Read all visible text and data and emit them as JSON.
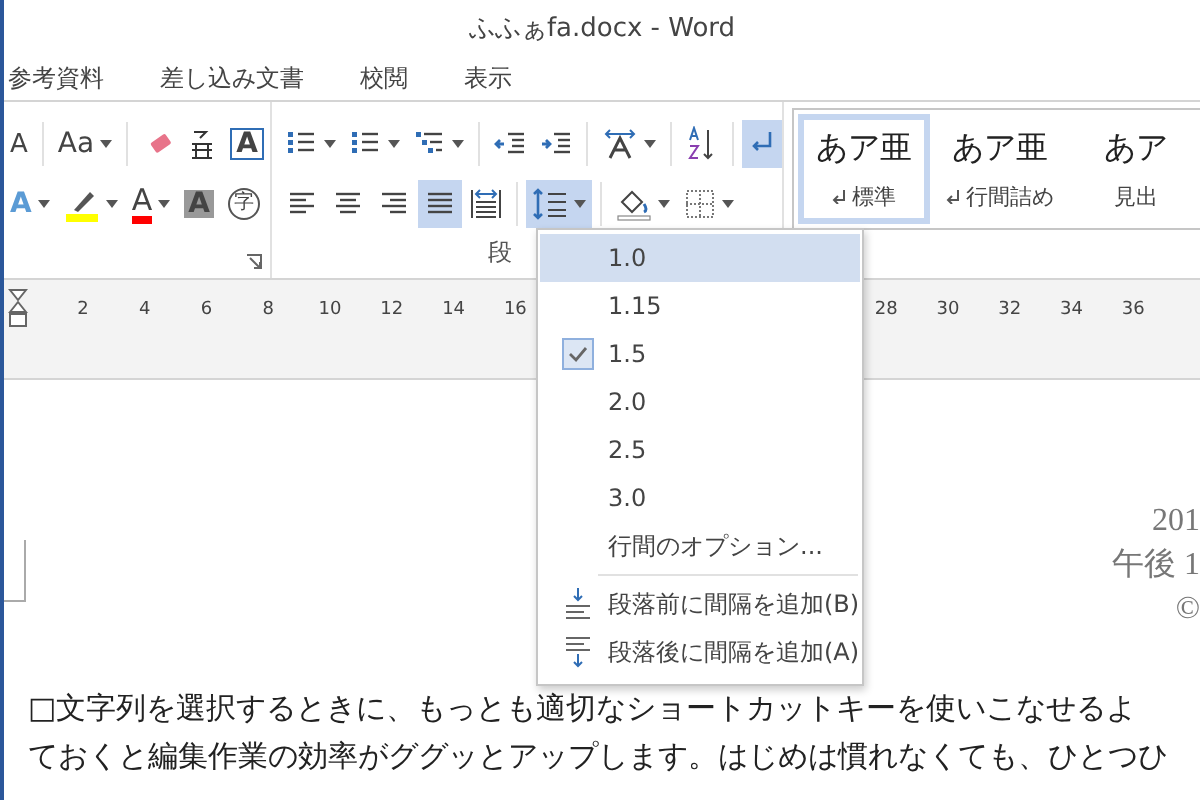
{
  "window": {
    "title": "ふふぁfa.docx - Word"
  },
  "tabs": [
    {
      "label": "参考資料",
      "selected": false
    },
    {
      "label": "差し込み文書",
      "selected": false
    },
    {
      "label": "校閲",
      "selected": false
    },
    {
      "label": "表示",
      "selected": false
    }
  ],
  "font_group": {
    "row1": [
      {
        "kind": "grow-font",
        "glyph": "A",
        "dropdown": false,
        "on": false
      },
      {
        "kind": "separator"
      },
      {
        "kind": "change-case",
        "glyph": "Aa",
        "dropdown": true,
        "on": false
      },
      {
        "kind": "separator"
      },
      {
        "kind": "clear-format",
        "dropdown": false,
        "on": false
      },
      {
        "kind": "furigana",
        "dropdown": false,
        "on": false
      },
      {
        "kind": "boxed-char",
        "glyph": "A",
        "dropdown": false,
        "on": false
      }
    ],
    "row2": [
      {
        "kind": "text-effects",
        "glyph": "A",
        "dropdown": true,
        "on": false
      },
      {
        "kind": "highlight",
        "dropdown": true,
        "on": false
      },
      {
        "kind": "font-color",
        "glyph": "A",
        "dropdown": true,
        "on": false
      },
      {
        "kind": "char-shading",
        "glyph": "A",
        "dropdown": false,
        "on": false
      },
      {
        "kind": "enclosed-char",
        "glyph": "字",
        "dropdown": false,
        "on": false
      }
    ]
  },
  "paragraph_group": {
    "label": "段",
    "row1": [
      {
        "kind": "bullets",
        "dropdown": true,
        "on": false
      },
      {
        "kind": "numbering",
        "dropdown": true,
        "on": false
      },
      {
        "kind": "multilevel",
        "dropdown": true,
        "on": false
      },
      {
        "kind": "separator"
      },
      {
        "kind": "outdent",
        "dropdown": false,
        "on": false
      },
      {
        "kind": "indent",
        "dropdown": false,
        "on": false
      },
      {
        "kind": "separator"
      },
      {
        "kind": "text-direction",
        "dropdown": true,
        "on": false
      },
      {
        "kind": "separator"
      },
      {
        "kind": "sort",
        "dropdown": false,
        "on": false
      },
      {
        "kind": "separator"
      },
      {
        "kind": "show-marks",
        "dropdown": false,
        "on": true
      }
    ],
    "row2": [
      {
        "kind": "align-left",
        "dropdown": false,
        "on": false
      },
      {
        "kind": "align-center",
        "dropdown": false,
        "on": false
      },
      {
        "kind": "align-right",
        "dropdown": false,
        "on": false
      },
      {
        "kind": "justify",
        "dropdown": false,
        "on": true
      },
      {
        "kind": "distribute",
        "dropdown": false,
        "on": false
      },
      {
        "kind": "separator"
      },
      {
        "kind": "line-spacing",
        "dropdown": true,
        "on": true
      },
      {
        "kind": "separator"
      },
      {
        "kind": "shading",
        "dropdown": true,
        "on": false
      },
      {
        "kind": "borders",
        "dropdown": true,
        "on": false
      }
    ]
  },
  "styles": [
    {
      "preview": "あア亜",
      "name": "標準",
      "paragraph_mark": true,
      "selected": true
    },
    {
      "preview": "あア亜",
      "name": "行間詰め",
      "paragraph_mark": true,
      "selected": false
    },
    {
      "preview": "あア",
      "name": "見出",
      "paragraph_mark": false,
      "selected": false
    }
  ],
  "ruler": {
    "left_numbers": [
      "2",
      "4",
      "6",
      "8",
      "10",
      "12",
      "14",
      "16"
    ],
    "right_numbers": [
      "28",
      "30",
      "32",
      "34",
      "36"
    ]
  },
  "document": {
    "side_lines": [
      "201",
      "午後 1",
      "©"
    ],
    "paragraphs": [
      "□文字列を選択するときに、もっとも適切なショートカットキーを使いこなせるよ",
      "ておくと編集作業の効率がググッとアップします。はじめは慣れなくても、ひとつひ"
    ]
  },
  "line_spacing_menu": {
    "items": [
      {
        "kind": "spacing",
        "label": "1.0",
        "highlighted": true,
        "checked": false
      },
      {
        "kind": "spacing",
        "label": "1.15",
        "highlighted": false,
        "checked": false
      },
      {
        "kind": "spacing",
        "label": "1.5",
        "highlighted": false,
        "checked": true
      },
      {
        "kind": "spacing",
        "label": "2.0",
        "highlighted": false,
        "checked": false
      },
      {
        "kind": "spacing",
        "label": "2.5",
        "highlighted": false,
        "checked": false
      },
      {
        "kind": "spacing",
        "label": "3.0",
        "highlighted": false,
        "checked": false
      },
      {
        "kind": "option",
        "label": "行間のオプション...",
        "highlighted": false,
        "checked": false
      },
      {
        "kind": "add-before",
        "label": "段落前に間隔を追加(B)",
        "highlighted": false,
        "checked": false
      },
      {
        "kind": "add-after",
        "label": "段落後に間隔を追加(A)",
        "highlighted": false,
        "checked": false
      }
    ]
  }
}
